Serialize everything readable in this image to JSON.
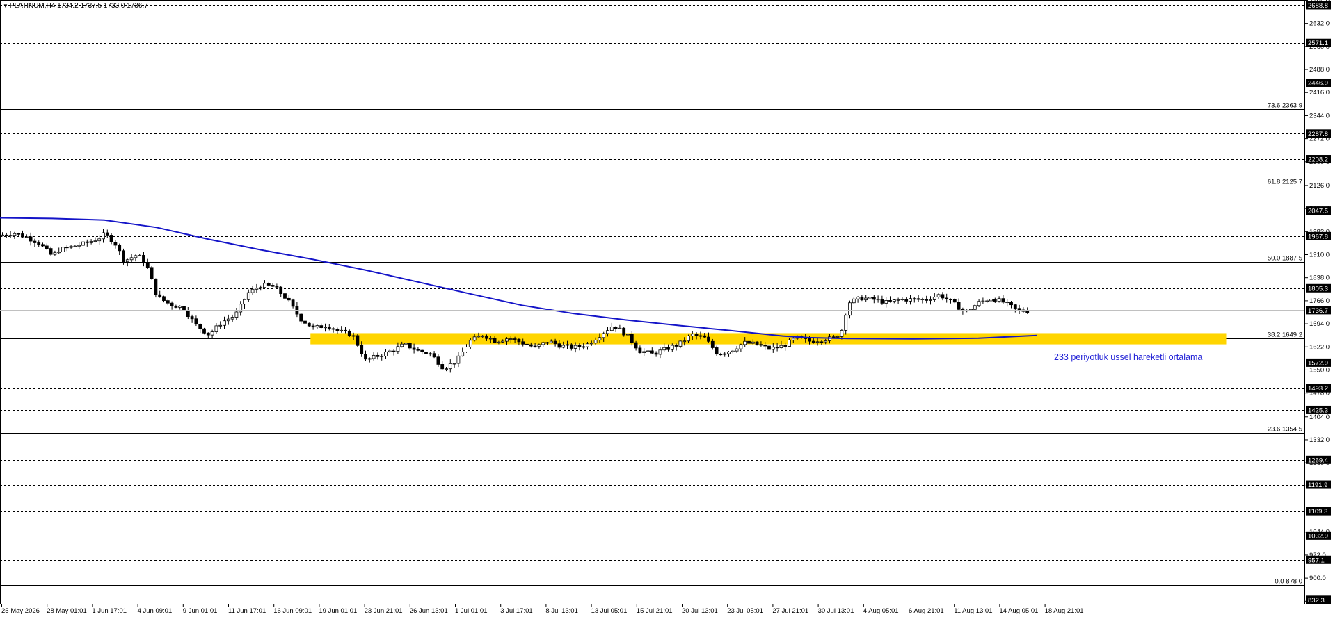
{
  "header": {
    "symbol_line": "PLATINUM,H4  1734.2 1737.5 1733.0 1736.7"
  },
  "colors": {
    "background": "#ffffff",
    "candle": "#000000",
    "ema": "#1414c8",
    "zone": "#ffd500",
    "grid_dashed": "#000000",
    "fib_line": "#000000",
    "current_price_line": "#c0c0c0",
    "annotation": "#1f1fd6"
  },
  "chart_data": {
    "type": "candlestick",
    "symbol": "PLATINUM",
    "timeframe": "H4",
    "ohlc_last": {
      "open": 1734.2,
      "high": 1737.5,
      "low": 1733.0,
      "close": 1736.7
    },
    "ylim": [
      820,
      2705
    ],
    "y_ticks": [
      "2704.0",
      "2632.0",
      "2560.0",
      "2488.0",
      "2416.0",
      "2344.0",
      "2272.0",
      "2200.0",
      "2126.0",
      "2054.0",
      "1982.0",
      "1910.0",
      "1838.0",
      "1766.0",
      "1694.0",
      "1622.0",
      "1550.0",
      "1478.0",
      "1404.0",
      "1332.0",
      "1260.0",
      "1188.0",
      "1116.0",
      "1044.0",
      "972.0",
      "900.0",
      "828.0"
    ],
    "x_ticks": [
      "25 May 2026",
      "28 May 01:01",
      "1 Jun 17:01",
      "4 Jun 09:01",
      "9 Jun 01:01",
      "11 Jun 17:01",
      "16 Jun 09:01",
      "19 Jun 01:01",
      "23 Jun 21:01",
      "26 Jun 13:01",
      "1 Jul 01:01",
      "3 Jul 17:01",
      "8 Jul 13:01",
      "13 Jul 05:01",
      "15 Jul 21:01",
      "20 Jul 13:01",
      "23 Jul 05:01",
      "27 Jul 21:01",
      "30 Jul 13:01",
      "4 Aug 05:01",
      "6 Aug 21:01",
      "11 Aug 13:01",
      "14 Aug 05:01",
      "18 Aug 21:01"
    ],
    "price_lines_dashed": [
      2688.8,
      2571.1,
      2446.9,
      2287.8,
      2208.2,
      2047.5,
      1967.8,
      1805.3,
      1572.9,
      1493.2,
      1425.3,
      1269.4,
      1191.9,
      1109.3,
      1032.9,
      957.1,
      832.3
    ],
    "price_labels": [
      "2688.8",
      "2571.1",
      "2446.9",
      "2287.8",
      "2208.2",
      "2047.5",
      "1967.8",
      "1805.3",
      "1572.9",
      "1493.2",
      "1425.3",
      "1269.4",
      "1191.9",
      "1109.3",
      "1032.9",
      "957.1",
      "832.3"
    ],
    "current_price": 1736.7,
    "current_price_label": "1736.7",
    "fibonacci": [
      {
        "value": 2363.9,
        "label": "73.6 2363.9"
      },
      {
        "value": 2125.7,
        "label": "61.8 2125.7"
      },
      {
        "value": 1887.5,
        "label": "50.0 1887.5"
      },
      {
        "value": 1649.2,
        "label": "38.2 1649.2"
      },
      {
        "value": 1354.5,
        "label": "23.6 1354.5"
      },
      {
        "value": 878.0,
        "label": "0.0 878.0"
      }
    ],
    "support_zone": {
      "low": 1630,
      "high": 1665,
      "x_start": 0.238,
      "x_end": 0.94
    },
    "ema_label": "233 periyotluk üssel hareketli ortalama",
    "ema_path": [
      [
        0.0,
        2025
      ],
      [
        0.04,
        2023
      ],
      [
        0.08,
        2018
      ],
      [
        0.12,
        1995
      ],
      [
        0.16,
        1958
      ],
      [
        0.2,
        1925
      ],
      [
        0.24,
        1895
      ],
      [
        0.28,
        1862
      ],
      [
        0.32,
        1825
      ],
      [
        0.36,
        1788
      ],
      [
        0.4,
        1752
      ],
      [
        0.44,
        1726
      ],
      [
        0.48,
        1706
      ],
      [
        0.52,
        1689
      ],
      [
        0.56,
        1673
      ],
      [
        0.6,
        1656
      ],
      [
        0.62,
        1651
      ],
      [
        0.65,
        1648
      ],
      [
        0.7,
        1647
      ],
      [
        0.75,
        1649
      ],
      [
        0.795,
        1658
      ]
    ],
    "price_path": [
      [
        0.0,
        1970
      ],
      [
        0.01,
        1978
      ],
      [
        0.02,
        1965
      ],
      [
        0.03,
        1945
      ],
      [
        0.04,
        1905
      ],
      [
        0.045,
        1925
      ],
      [
        0.055,
        1935
      ],
      [
        0.065,
        1945
      ],
      [
        0.075,
        1960
      ],
      [
        0.08,
        1975
      ],
      [
        0.088,
        1945
      ],
      [
        0.095,
        1890
      ],
      [
        0.105,
        1910
      ],
      [
        0.112,
        1880
      ],
      [
        0.12,
        1780
      ],
      [
        0.13,
        1755
      ],
      [
        0.14,
        1745
      ],
      [
        0.15,
        1690
      ],
      [
        0.16,
        1660
      ],
      [
        0.17,
        1700
      ],
      [
        0.18,
        1720
      ],
      [
        0.19,
        1790
      ],
      [
        0.2,
        1815
      ],
      [
        0.21,
        1810
      ],
      [
        0.22,
        1770
      ],
      [
        0.23,
        1710
      ],
      [
        0.24,
        1680
      ],
      [
        0.25,
        1690
      ],
      [
        0.26,
        1670
      ],
      [
        0.27,
        1660
      ],
      [
        0.28,
        1580
      ],
      [
        0.29,
        1595
      ],
      [
        0.3,
        1610
      ],
      [
        0.31,
        1630
      ],
      [
        0.32,
        1610
      ],
      [
        0.33,
        1600
      ],
      [
        0.34,
        1555
      ],
      [
        0.35,
        1580
      ],
      [
        0.36,
        1640
      ],
      [
        0.37,
        1660
      ],
      [
        0.38,
        1640
      ],
      [
        0.39,
        1650
      ],
      [
        0.4,
        1635
      ],
      [
        0.41,
        1620
      ],
      [
        0.42,
        1640
      ],
      [
        0.43,
        1625
      ],
      [
        0.44,
        1620
      ],
      [
        0.45,
        1630
      ],
      [
        0.46,
        1660
      ],
      [
        0.47,
        1690
      ],
      [
        0.48,
        1660
      ],
      [
        0.49,
        1610
      ],
      [
        0.5,
        1600
      ],
      [
        0.51,
        1615
      ],
      [
        0.52,
        1630
      ],
      [
        0.53,
        1660
      ],
      [
        0.54,
        1650
      ],
      [
        0.55,
        1600
      ],
      [
        0.56,
        1610
      ],
      [
        0.57,
        1635
      ],
      [
        0.58,
        1630
      ],
      [
        0.59,
        1615
      ],
      [
        0.6,
        1625
      ],
      [
        0.61,
        1650
      ],
      [
        0.62,
        1640
      ],
      [
        0.63,
        1645
      ],
      [
        0.64,
        1650
      ],
      [
        0.645,
        1675
      ],
      [
        0.65,
        1760
      ],
      [
        0.66,
        1775
      ],
      [
        0.67,
        1770
      ],
      [
        0.68,
        1760
      ],
      [
        0.69,
        1770
      ],
      [
        0.7,
        1770
      ],
      [
        0.71,
        1770
      ],
      [
        0.72,
        1785
      ],
      [
        0.73,
        1760
      ],
      [
        0.74,
        1730
      ],
      [
        0.75,
        1760
      ],
      [
        0.76,
        1775
      ],
      [
        0.77,
        1760
      ],
      [
        0.78,
        1735
      ],
      [
        0.79,
        1735
      ]
    ]
  }
}
